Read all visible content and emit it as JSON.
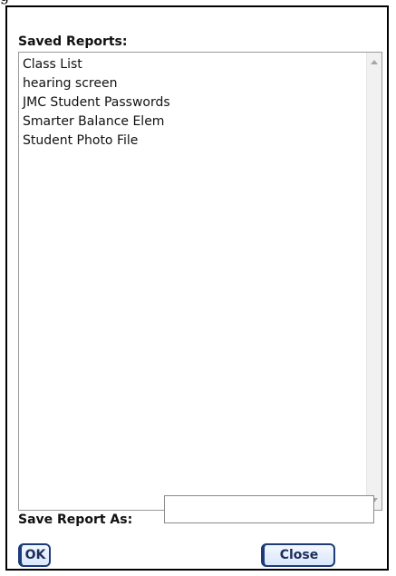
{
  "clipped_header_text": "g",
  "saved_reports": {
    "label": "Saved Reports:",
    "items": [
      "Class List",
      "hearing screen",
      "JMC Student Passwords",
      "Smarter Balance Elem",
      "Student Photo File"
    ]
  },
  "save_as": {
    "label": "Save Report As:",
    "value": ""
  },
  "buttons": {
    "ok": "OK",
    "close": "Close"
  },
  "icons": {
    "scroll_up": "chevron-up-icon",
    "scroll_down": "chevron-down-icon"
  },
  "colors": {
    "button_border": "#1d3c77",
    "button_text": "#1a2e5a",
    "scrollbar_track": "#f1f1f1"
  }
}
